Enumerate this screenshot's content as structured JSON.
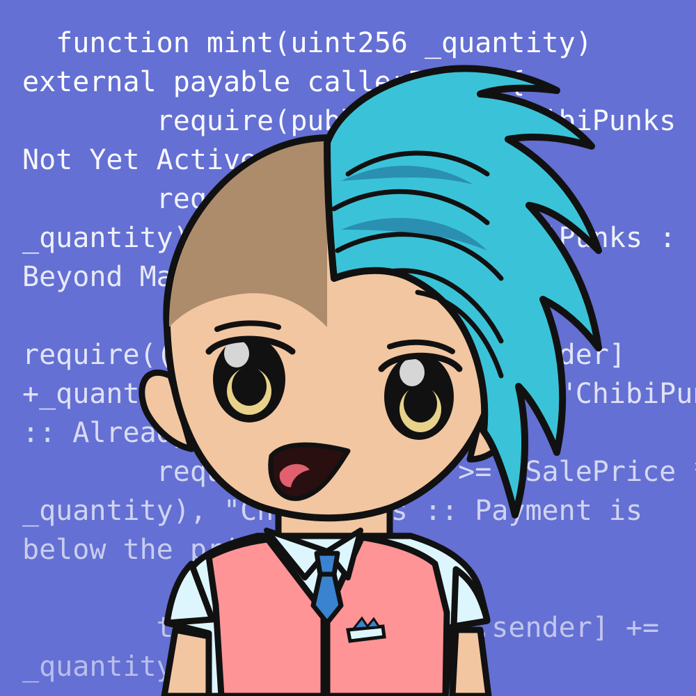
{
  "code_lines": [
    {
      "text": "  function mint(uint256 _quantity)"
    },
    {
      "text": "external payable callerIsUser{"
    },
    {
      "text": "        require(publicSale, \"ChibiPunks"
    },
    {
      "text": "Not Yet Active.\");"
    },
    {
      "text": "        require((totalSupply() +"
    },
    {
      "text": "_quantity) <= MAX_SUPPLY, \"ChibiPunks :"
    },
    {
      "text": "Beyond Max Supply\");"
    },
    {
      "text": ""
    },
    {
      "text": "require((totalPublicMint[msg.sender]"
    },
    {
      "text": "+_quantity) <= MAX_PUBLIC_MINT, \"ChibiPunks"
    },
    {
      "text": ":: Already minted 3 times!\");"
    },
    {
      "text": "        require(msg.value >= (SalePrice *"
    },
    {
      "text": "_quantity), \"ChibiPunks :: Payment is"
    },
    {
      "text": "below the price\");"
    },
    {
      "text": ""
    },
    {
      "text": "        totalPublicMint[msg.sender] +="
    },
    {
      "text": "_quantity;"
    }
  ],
  "colors": {
    "background": "#6470d3",
    "hair": "#3ac3d8",
    "hair_shadow": "#2a8fb0",
    "scalp": "#ad8c6c",
    "skin": "#f2c6a1",
    "vest": "#ff9497",
    "shirt": "#ddf6fe",
    "tie": "#3a83d0",
    "outline": "#111111"
  }
}
